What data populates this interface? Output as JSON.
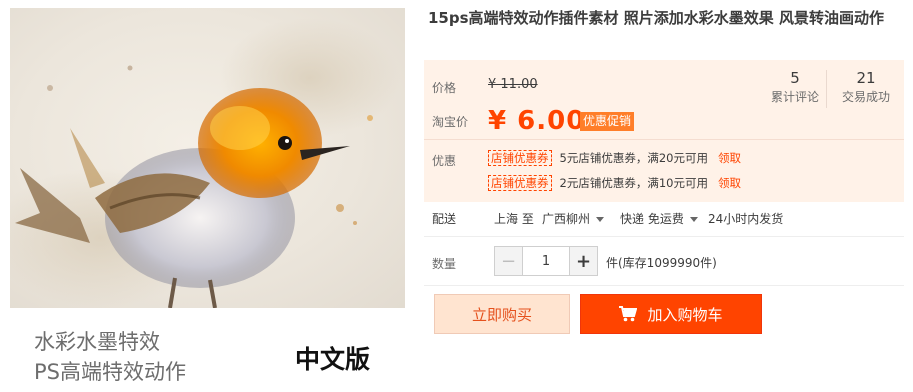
{
  "product": {
    "title": "15ps高端特效动作插件素材 照片添加水彩水墨效果 风景转油画动作"
  },
  "gallery": {
    "caption_line1": "水彩水墨特效",
    "caption_line2": "PS高端特效动作",
    "badge": "中文版"
  },
  "pricing": {
    "original_label": "价格",
    "original_price": "¥ 11.00",
    "taobao_label": "淘宝价",
    "current_price": "¥ 6.00",
    "promo_tag": "优惠促销"
  },
  "stats": [
    {
      "value": "5",
      "label": "累计评论"
    },
    {
      "value": "21",
      "label": "交易成功"
    }
  ],
  "coupons": {
    "label": "优惠",
    "items": [
      {
        "tag": "店铺优惠券",
        "text": "5元店铺优惠券，满20元可用",
        "link": "领取"
      },
      {
        "tag": "店铺优惠券",
        "text": "2元店铺优惠券，满10元可用",
        "link": "领取"
      }
    ]
  },
  "shipping": {
    "label": "配送",
    "from": "上海 至",
    "to": "广西柳州",
    "method": "快递 免运费",
    "dispatch": "24小时内发货"
  },
  "quantity": {
    "label": "数量",
    "value": "1",
    "minus": "−",
    "plus": "+",
    "stock": "件(库存1099990件)"
  },
  "actions": {
    "buy_now": "立即购买",
    "add_to_cart": "加入购物车"
  },
  "colors": {
    "accent": "#ff4400",
    "price_bg": "#fff2e8",
    "buy_bg": "#ffe4d0"
  },
  "icons": {
    "cart": "cart-icon",
    "caret": "chevron-down-icon"
  }
}
